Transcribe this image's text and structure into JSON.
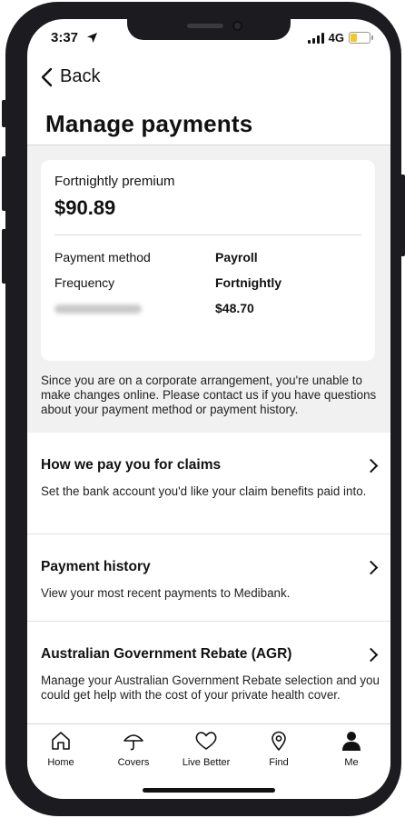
{
  "status_bar": {
    "time": "3:37",
    "network": "4G",
    "battery_level": 0.4
  },
  "nav": {
    "back_label": "Back"
  },
  "page": {
    "title": "Manage payments"
  },
  "premium_card": {
    "label": "Fortnightly premium",
    "amount": "$90.89",
    "rows": [
      {
        "key": "Payment method",
        "value": "Payroll"
      },
      {
        "key": "Frequency",
        "value": "Fortnightly"
      },
      {
        "key": "",
        "value": "$48.70"
      }
    ]
  },
  "notice": "Since you are on a corporate arrangement, you're unable to make changes online. Please contact us if you have questions about your payment method or payment history.",
  "sections": [
    {
      "title": "How we pay you for claims",
      "description": "Set the bank account you'd like your claim benefits paid into."
    },
    {
      "title": "Payment history",
      "description": "View your most recent payments to Medibank."
    },
    {
      "title": "Australian Government Rebate (AGR)",
      "description": "Manage your Australian Government Rebate selection and you could get help with the cost of your private health cover."
    }
  ],
  "tabbar": {
    "items": [
      {
        "label": "Home",
        "icon": "home-icon"
      },
      {
        "label": "Covers",
        "icon": "umbrella-icon"
      },
      {
        "label": "Live Better",
        "icon": "heart-icon"
      },
      {
        "label": "Find",
        "icon": "location-pin-icon"
      },
      {
        "label": "Me",
        "icon": "person-icon"
      }
    ],
    "active": "Me"
  }
}
